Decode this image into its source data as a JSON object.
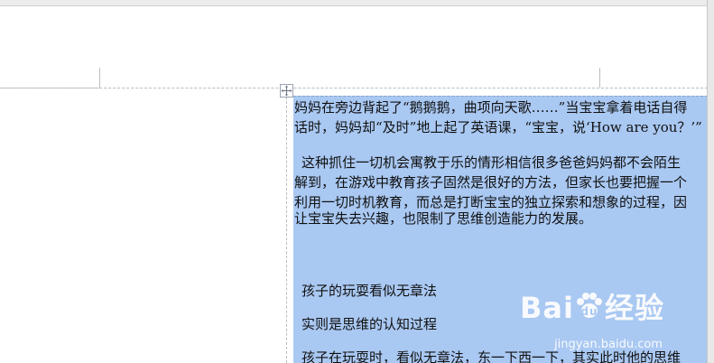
{
  "document": {
    "paragraphs": [
      "妈妈在旁边背起了“鹅鹅鹅，曲项向天歌……”当宝宝拿着电话自得",
      "话时，妈妈却“及时”地上起了英语课，“宝宝，说‘How are you？’”",
      "这种抓住一切机会寓教于乐的情形相信很多爸爸妈妈都不会陌生",
      "解到，在游戏中教育孩子固然是很好的方法，但家长也要把握一个",
      "利用一切时机教育，而总是打断宝宝的独立探索和想象的过程，因",
      "让宝宝失去兴趣，也限制了思维创造能力的发展。",
      "孩子的玩耍看似无章法",
      "实则是思维的认知过程",
      "孩子在玩耍时，看似无章法，东一下西一下，其实此时他的思维"
    ]
  },
  "watermark": {
    "brand": "Bai",
    "brand_suffix": "经验",
    "url": "jingyan.baidu.com"
  },
  "colors": {
    "selection": "#a9c8f2",
    "guide": "#b7bcc4"
  }
}
